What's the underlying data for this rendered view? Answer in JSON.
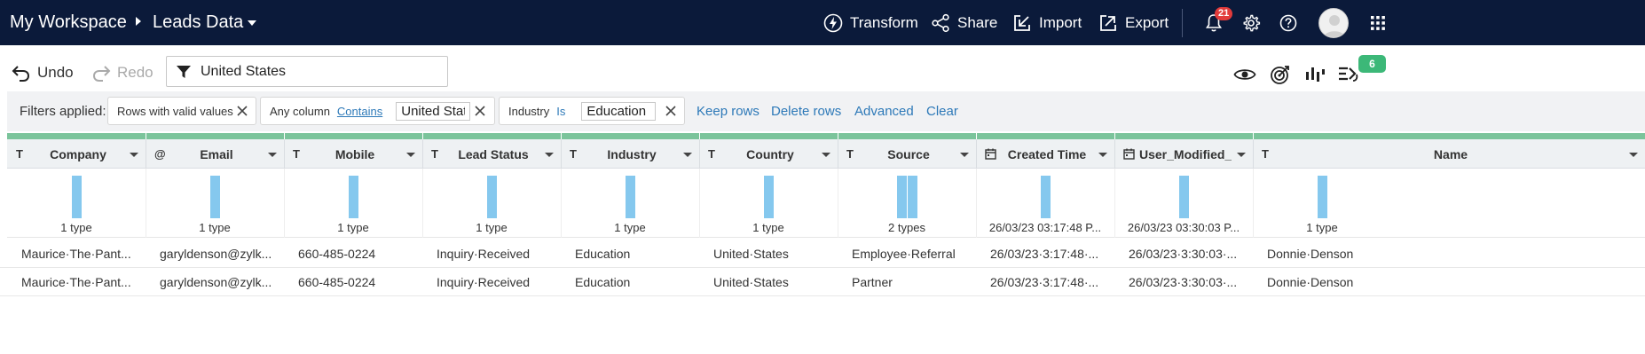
{
  "topbar": {
    "workspace": "My Workspace",
    "dataset": "Leads Data",
    "transform_label": "Transform",
    "share_label": "Share",
    "import_label": "Import",
    "export_label": "Export",
    "notification_count": "21"
  },
  "toolbar": {
    "undo_label": "Undo",
    "redo_label": "Redo",
    "filter_value": "United States",
    "rule_badge_count": "6"
  },
  "filters": {
    "label": "Filters applied:",
    "chip1": "Rows with valid values",
    "chip2_prefix": "Any column",
    "chip2_op": "Contains",
    "chip2_value": "United States",
    "chip3_prefix": "Industry",
    "chip3_op": "Is",
    "chip3_value": "Education",
    "keep_rows": "Keep rows",
    "delete_rows": "Delete rows",
    "advanced": "Advanced",
    "clear": "Clear"
  },
  "columns": [
    {
      "type_icon": "T",
      "name": "Company",
      "profile": "1 type"
    },
    {
      "type_icon": "@",
      "name": "Email",
      "profile": "1 type"
    },
    {
      "type_icon": "T",
      "name": "Mobile",
      "profile": "1 type"
    },
    {
      "type_icon": "T",
      "name": "Lead Status",
      "profile": "1 type"
    },
    {
      "type_icon": "T",
      "name": "Industry",
      "profile": "1 type"
    },
    {
      "type_icon": "T",
      "name": "Country",
      "profile": "1 type"
    },
    {
      "type_icon": "T",
      "name": "Source",
      "profile": "2 types"
    },
    {
      "type_icon": "calendar-icon",
      "name": "Created Time",
      "profile": "26/03/23 03:17:48 P..."
    },
    {
      "type_icon": "calendar-icon",
      "name": "User_Modified_...",
      "profile": "26/03/23 03:30:03 P..."
    },
    {
      "type_icon": "T",
      "name": "Name",
      "profile": "1 type"
    }
  ],
  "rows": [
    [
      "Maurice·The·Pant...",
      "garyldenson@zylk...",
      "660-485-0224",
      "Inquiry·Received",
      "Education",
      "United·States",
      "Employee·Referral",
      "26/03/23·3:17:48·...",
      "26/03/23·3:30:03·...",
      "Donnie·Denson"
    ],
    [
      "Maurice·The·Pant...",
      "garyldenson@zylk...",
      "660-485-0224",
      "Inquiry·Received",
      "Education",
      "United·States",
      "Partner",
      "26/03/23·3:17:48·...",
      "26/03/23·3:30:03·...",
      "Donnie·Denson"
    ]
  ],
  "colors": {
    "nav_bg": "#0b1a3a",
    "link": "#2d79b8",
    "profile_bar": "#85c8ee",
    "strip": "#7bc49b",
    "badge_red": "#e23b3b",
    "badge_green": "#3cb878"
  }
}
